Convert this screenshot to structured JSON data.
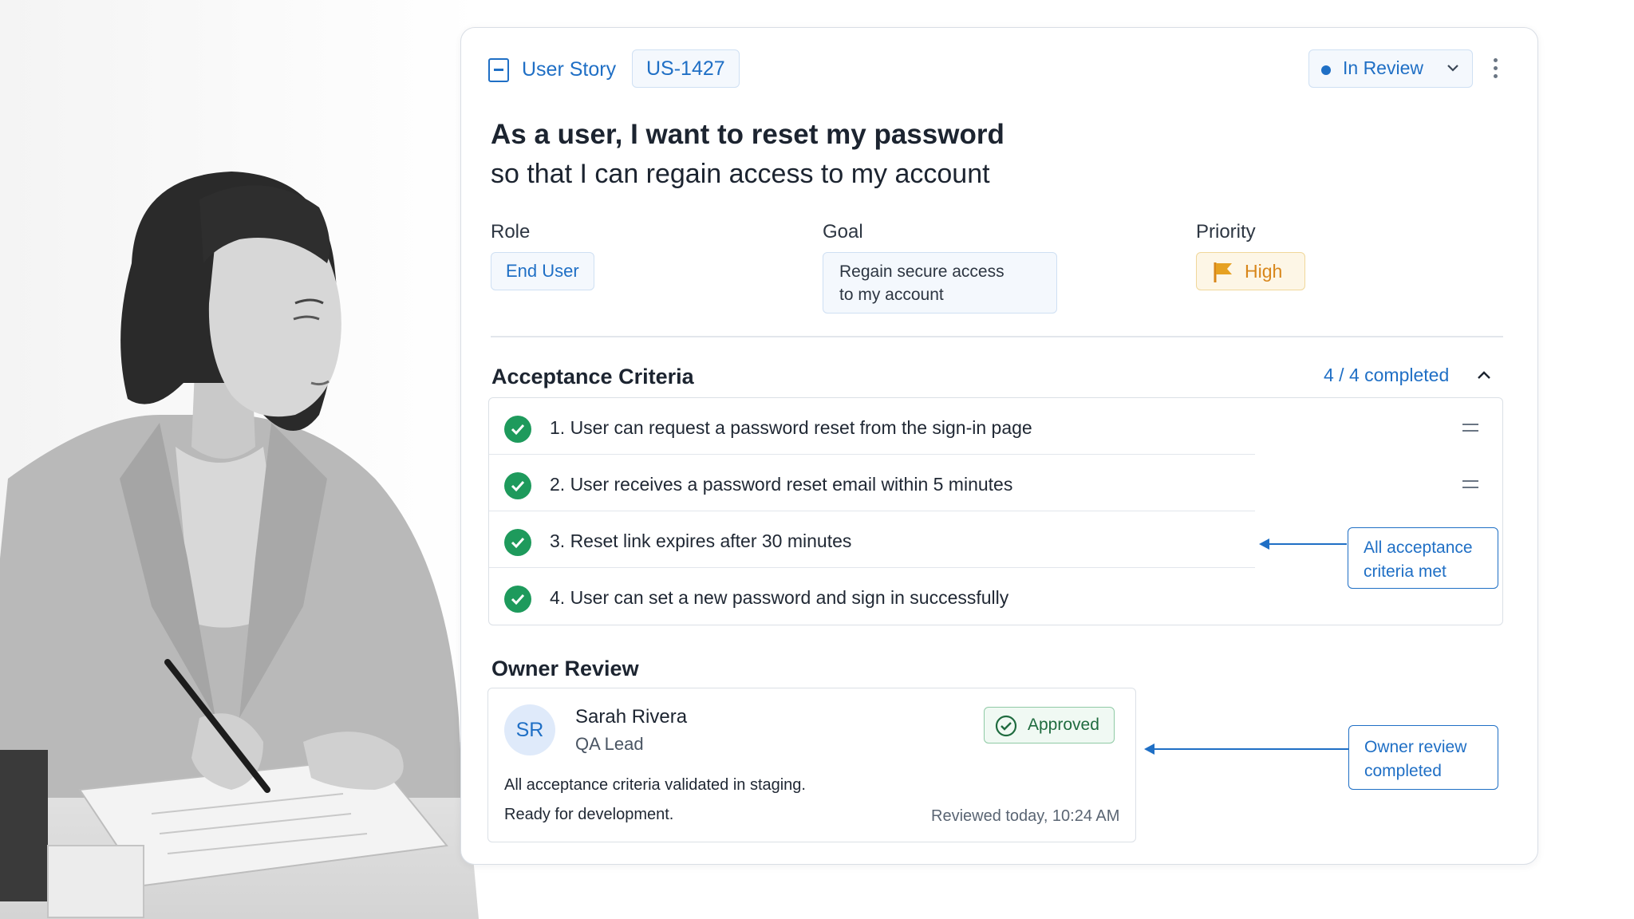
{
  "story": {
    "type_label": "User Story",
    "id": "US-1427",
    "status": "In Review",
    "title_line1": "As a user, I want to reset my password",
    "title_line2": "so that I can regain access to my account"
  },
  "fields": {
    "role_label": "Role",
    "role_value": "End User",
    "goal_label": "Goal",
    "goal_value_line1": "Regain secure access",
    "goal_value_line2": "to my account",
    "priority_label": "Priority",
    "priority_value": "High"
  },
  "acceptance": {
    "title": "Acceptance Criteria",
    "progress": "4 / 4 completed",
    "items": [
      {
        "text": "1.  User can request a password reset from the sign-in page",
        "done": true
      },
      {
        "text": "2.  User receives a password reset email within 5 minutes",
        "done": true
      },
      {
        "text": "3.  Reset link expires after 30 minutes",
        "done": true
      },
      {
        "text": "4.  User can set a new password and sign in successfully",
        "done": true
      }
    ]
  },
  "callouts": {
    "criteria_line1": "All acceptance",
    "criteria_line2": "criteria met",
    "review_line1": "Owner review",
    "review_line2": "completed"
  },
  "review": {
    "title": "Owner Review",
    "initials": "SR",
    "name": "Sarah Rivera",
    "role": "QA Lead",
    "status": "Approved",
    "note_line1": "All acceptance criteria validated in staging.",
    "note_line2": "Ready for development.",
    "timestamp": "Reviewed today, 10:24 AM"
  },
  "icons": {
    "story": "story-icon",
    "status_dropdown": "chevron-down-icon",
    "menu": "kebab-menu-icon",
    "priority": "flag-icon",
    "collapse": "chevron-up-icon",
    "criterion": "check-circle-icon",
    "reorder": "drag-handle-icon",
    "approved": "check-circle-outline-icon"
  },
  "colors": {
    "accent": "#1f6fc5",
    "success": "#1e9a5c",
    "priority_high": "#d8861a"
  }
}
